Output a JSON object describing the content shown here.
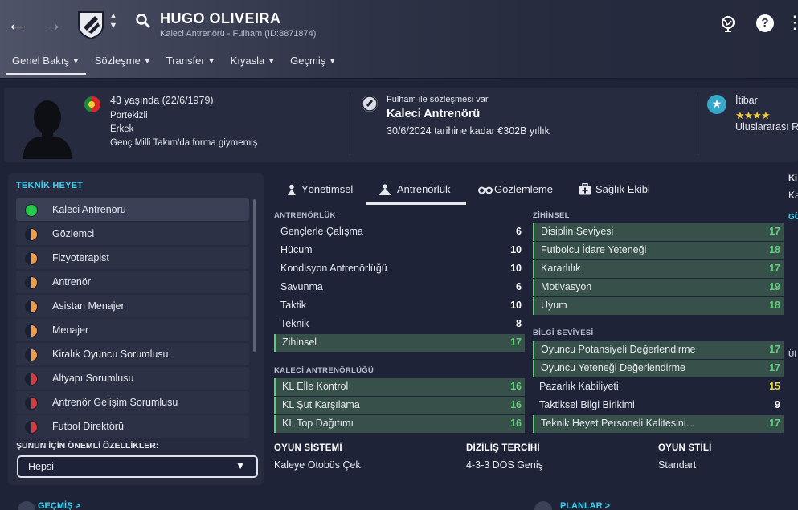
{
  "header": {
    "name": "HUGO OLIVEIRA",
    "subtitle": "Kaleci Antrenörü - Fulham (ID:8871874)",
    "back_icon": "arrow-left",
    "forward_icon": "arrow-right",
    "help_label": "?",
    "more_label": "⋮"
  },
  "tabs": [
    {
      "label": "Genel Bakış"
    },
    {
      "label": "Sözleşme"
    },
    {
      "label": "Transfer"
    },
    {
      "label": "Kıyasla"
    },
    {
      "label": "Geçmiş"
    }
  ],
  "info": {
    "age": "43 yaşında (22/6/1979)",
    "nationality": "Portekizli",
    "gender": "Erkek",
    "youth": "Genç Milli Takım'da forma giymemiş",
    "contract_note": "Fulham ile sözleşmesi var",
    "role": "Kaleci Antrenörü",
    "contract_detail": "30/6/2024 tarihine kadar €302B yıllık",
    "reputation_label": "İtibar",
    "reputation_stars": "★★★★",
    "reputation_level": "Uluslararası R",
    "flag_colors": {
      "green": "#1c8a3a",
      "red": "#d52a2a"
    }
  },
  "staff": {
    "heading": "TEKNİK HEYET",
    "items": [
      {
        "label": "Kaleci Antrenörü",
        "status": "green"
      },
      {
        "label": "Gözlemci",
        "status": "half-orange"
      },
      {
        "label": "Fizyoterapist",
        "status": "half-orange"
      },
      {
        "label": "Antrenör",
        "status": "half-orange"
      },
      {
        "label": "Asistan Menajer",
        "status": "half-orange"
      },
      {
        "label": "Menajer",
        "status": "half-orange"
      },
      {
        "label": "Kiralık Oyuncu Sorumlusu",
        "status": "half-orange"
      },
      {
        "label": "Altyapı Sorumlusu",
        "status": "half-red"
      },
      {
        "label": "Antrenör Gelişim Sorumlusu",
        "status": "half-red"
      },
      {
        "label": "Futbol Direktörü",
        "status": "half-red"
      }
    ],
    "important_label": "ŞUNUN İÇİN ÖNEMLİ ÖZELLİKLER:",
    "dropdown_value": "Hepsi"
  },
  "subtabs": [
    {
      "label": "Yönetimsel"
    },
    {
      "label": "Antrenörlük"
    },
    {
      "label": "Gözlemleme"
    },
    {
      "label": "Sağlık Ekibi"
    }
  ],
  "coaching": {
    "heading": "ANTRENÖRLÜK",
    "rows": [
      {
        "label": "Gençlerle Çalışma",
        "value": "6"
      },
      {
        "label": "Hücum",
        "value": "10"
      },
      {
        "label": "Kondisyon Antrenörlüğü",
        "value": "10"
      },
      {
        "label": "Savunma",
        "value": "6"
      },
      {
        "label": "Taktik",
        "value": "10"
      },
      {
        "label": "Teknik",
        "value": "8"
      },
      {
        "label": "Zihinsel",
        "value": "17"
      }
    ]
  },
  "gk_coaching": {
    "heading": "KALECİ ANTRENÖRLÜĞÜ",
    "rows": [
      {
        "label": "KL Elle Kontrol",
        "value": "16"
      },
      {
        "label": "KL Şut Karşılama",
        "value": "16"
      },
      {
        "label": "KL Top Dağıtımı",
        "value": "16"
      }
    ]
  },
  "mental": {
    "heading": "ZİHİNSEL",
    "rows": [
      {
        "label": "Disiplin Seviyesi",
        "value": "17"
      },
      {
        "label": "Futbolcu İdare Yeteneği",
        "value": "18"
      },
      {
        "label": "Kararlılık",
        "value": "17"
      },
      {
        "label": "Motivasyon",
        "value": "19"
      },
      {
        "label": "Uyum",
        "value": "18"
      }
    ]
  },
  "knowledge": {
    "heading": "BİLGİ SEVİYESİ",
    "rows": [
      {
        "label": "Oyuncu Potansiyeli Değerlendirme",
        "value": "17"
      },
      {
        "label": "Oyuncu Yeteneği Değerlendirme",
        "value": "17"
      },
      {
        "label": "Pazarlık Kabiliyeti",
        "value": "15"
      },
      {
        "label": "Taktiksel Bilgi Birikimi",
        "value": "9"
      },
      {
        "label": "Teknik Heyet Personeli Kalitesini...",
        "value": "17"
      }
    ]
  },
  "preferences": {
    "system_label": "OYUN SİSTEMİ",
    "system_value": "Kaleye Otobüs Çek",
    "formation_label": "DİZİLİŞ TERCİHİ",
    "formation_value": "4-3-3 DOS Geniş",
    "style_label": "OYUN STİLİ",
    "style_value": "Standart"
  },
  "bottom": {
    "history": "GEÇMİŞ >",
    "plans": "PLANLAR >"
  },
  "right_edge": {
    "top": "Ki",
    "second": "Ka",
    "third": "GÖ",
    "fourth": "Ül"
  },
  "colors": {
    "accent_cyan": "#3fd3f2",
    "value_green": "#5fd07a",
    "value_yellow": "#e8d53a",
    "highlight": "#37504a",
    "status_green": "#27c84a",
    "status_orange": "#f39a45",
    "status_red": "#d83b3b"
  }
}
